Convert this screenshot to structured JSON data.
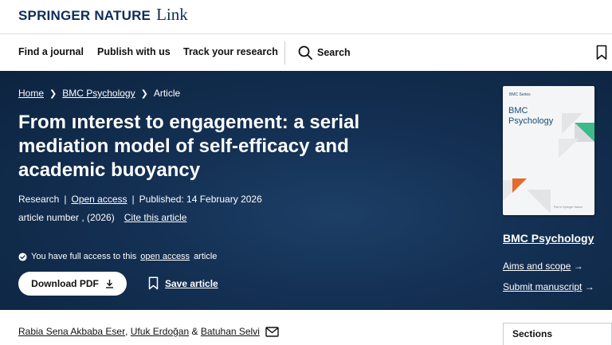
{
  "brand": {
    "name": "SPRINGER NATURE",
    "suffix": "Link"
  },
  "nav": {
    "items": [
      "Find a journal",
      "Publish with us",
      "Track your research"
    ],
    "search_label": "Search"
  },
  "breadcrumb": {
    "home": "Home",
    "journal": "BMC Psychology",
    "current": "Article"
  },
  "article": {
    "title": "From ınterest to engagement: a serial mediation model of self-efficacy and academic buoyancy",
    "type": "Research",
    "access": "Open access",
    "published": "Published: 14 February 2026",
    "article_number": "article number , (2026)",
    "cite": "Cite this article"
  },
  "access_note": {
    "prefix": "You have full access to this",
    "link": "open access",
    "suffix": "article"
  },
  "actions": {
    "download": "Download PDF",
    "save": "Save article"
  },
  "cover": {
    "series": "BMC Series",
    "name": "BMC Psychology",
    "footer": "Part of Springer Nature"
  },
  "journal": {
    "title": "BMC Psychology",
    "aims": "Aims and scope",
    "submit": "Submit manuscript"
  },
  "authors": [
    "Rabia Sena Akbaba Eser",
    "Ufuk Erdoğan",
    "Batuhan Selvi"
  ],
  "sections_label": "Sections",
  "colors": {
    "hero_bg": "#132f52",
    "brand": "#0d2d57",
    "cover_green": "#3dba8a",
    "cover_orange": "#e46a2e"
  }
}
